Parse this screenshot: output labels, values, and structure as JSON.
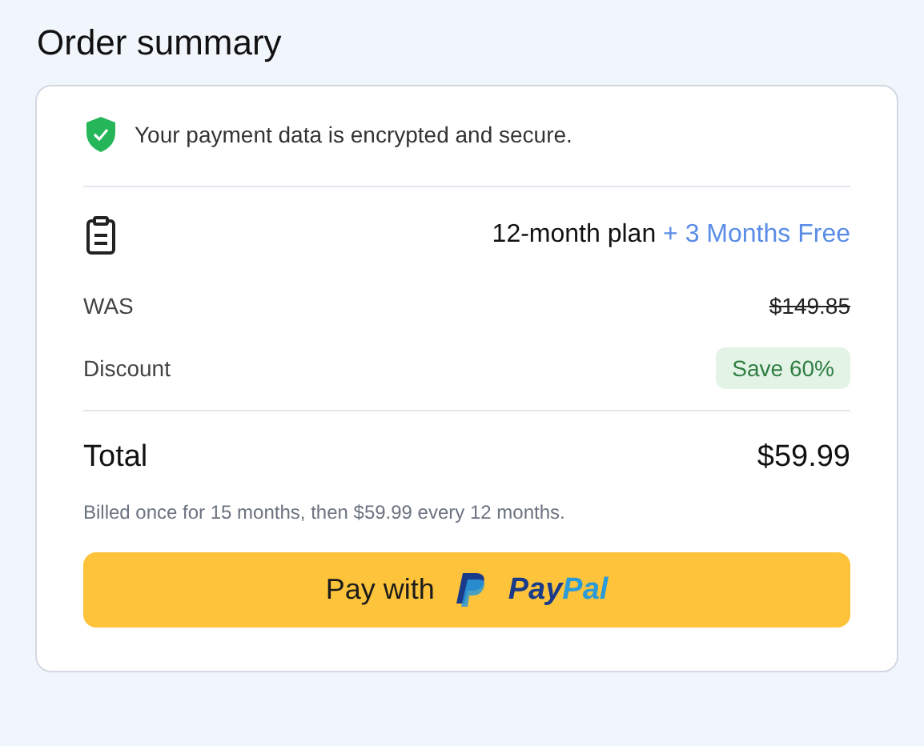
{
  "title": "Order summary",
  "security": {
    "text": "Your payment data is encrypted and secure."
  },
  "plan": {
    "name": "12-month plan",
    "bonus": "+ 3 Months Free"
  },
  "rows": [
    {
      "kind": "strike",
      "label": "WAS",
      "value": "$149.85"
    },
    {
      "kind": "badge",
      "label": "Discount",
      "value": "Save 60%"
    }
  ],
  "total": {
    "label": "Total",
    "value": "$59.99"
  },
  "note": "Billed once for 15 months, then $59.99 every 12 months.",
  "pay_button": {
    "label": "Pay with",
    "logo": [
      "Pay",
      "Pal"
    ]
  }
}
